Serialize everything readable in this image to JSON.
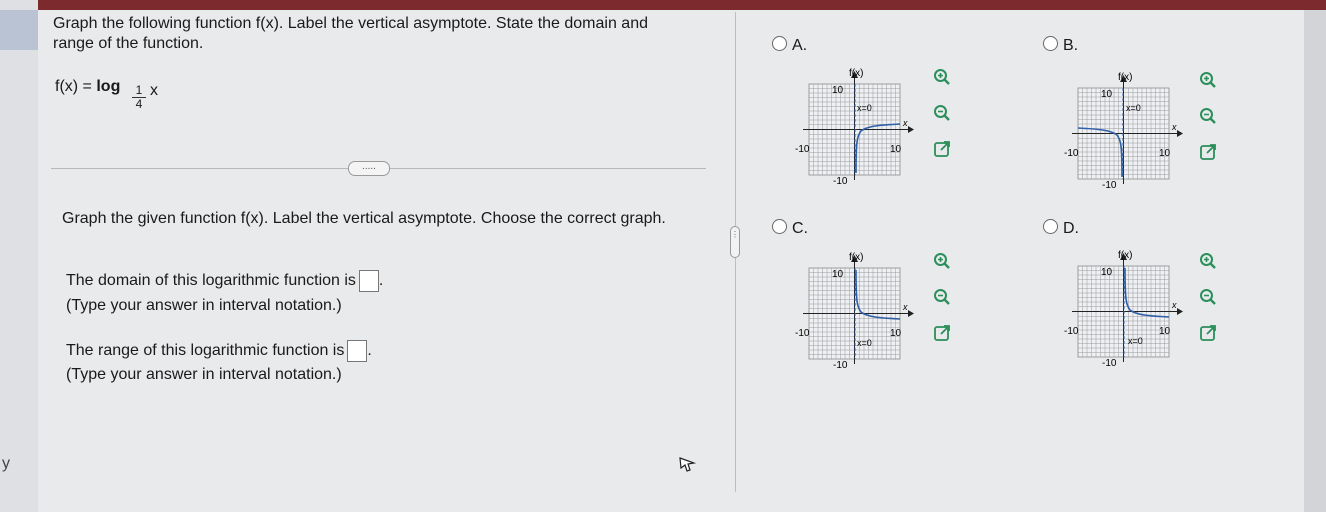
{
  "question": {
    "prompt": "Graph the following function f(x). Label the vertical asymptote. State the domain and range of the function.",
    "function_prefix": "f(x) = ",
    "function_log": "log",
    "base_num": "1",
    "base_den": "4",
    "function_arg": "x"
  },
  "divider": {
    "more_label": "....."
  },
  "instructions": "Graph the given function f(x). Label the vertical asymptote. Choose the correct graph.",
  "domain": {
    "label": "The domain of this logarithmic function is",
    "hint": "(Type your answer in interval notation.)",
    "value": ""
  },
  "range": {
    "label": "The range of this logarithmic function is",
    "hint": "(Type your answer in interval notation.)",
    "value": ""
  },
  "side_handle": "⋮",
  "options": [
    {
      "letter": "A.",
      "axis_label": "f(x)",
      "tick_pos": "10",
      "tick_neg": "-10",
      "x_label": "x",
      "asymptote_label": "x=0"
    },
    {
      "letter": "B.",
      "axis_label": "f(x)",
      "tick_pos": "10",
      "tick_neg": "-10",
      "x_label": "x",
      "asymptote_label": "x=0"
    },
    {
      "letter": "C.",
      "axis_label": "f(x)",
      "tick_pos": "10",
      "tick_neg": "-10",
      "x_label": "x",
      "asymptote_label": "x=0"
    },
    {
      "letter": "D.",
      "axis_label": "f(x)",
      "tick_pos": "10",
      "tick_neg": "-10",
      "x_label": "x",
      "asymptote_label": "x=0"
    }
  ],
  "left_edge_letter": "y",
  "colors": {
    "header": "#7c2a2e",
    "curve": "#2f5fa8",
    "tool_icon": "#2a8f5a"
  }
}
